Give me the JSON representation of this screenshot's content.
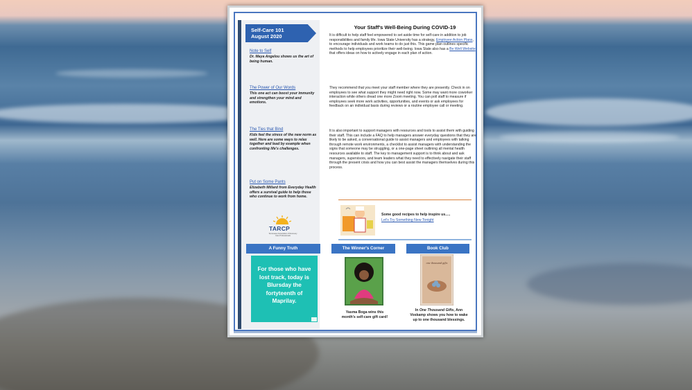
{
  "sidebar": {
    "banner": [
      "Self-Care 101",
      "August 2020"
    ],
    "items": [
      {
        "link": "Note to Self",
        "desc": "Dr. Maya Angelou shows us the art of being human."
      },
      {
        "link": "The Power of Our Words",
        "desc": "This one act can boost your immunity and strengthen your mind and emotions."
      },
      {
        "link": "The Ties that Bind",
        "desc": "Kids feel the stress of the new norm as well.  Here are some ways to relax together and lead by example when confronting life's challenges."
      },
      {
        "link": "Put on Some Pants",
        "desc": "Elizabeth Millard from Everyday Health offers a survival guide to help those who continue to work from home."
      }
    ],
    "logo": {
      "name": "TARCP",
      "sub": "Tennessee Association of Recovery Care Professionals"
    }
  },
  "article": {
    "title": "Your Staff's Well-Being During COVID-19",
    "p1_a": "It is difficult to help staff feel empowered to set aside time for self-care in addition to job responsibilities and family life. Iowa State University has a strategy, ",
    "p1_link1": "Employee Action Plans",
    "p1_b": ", to encourage individuals and work teams to do just this. This game plan outlines specific methods to help employees prioritize their well-being. Iowa State also has a ",
    "p1_link2": "Be Well Website",
    "p1_c": " that offers ideas on how to actively engage in each plan of action.",
    "p2": "They recommend that you meet your staff member where they are presently.  Check in on employees to see what support they might need right now.  Some may want more coworker interaction while others dread one more Zoom meeting.  You can poll staff to measure if employees seek more work activities, opportunities, and events or ask employees for feedback on an individual basis during reviews or a routine employee call or meeting.",
    "p3": "It is also important to support managers with resources and tools to assist them with guiding their staff.  This can include a FAQ to help managers answer everyday questions that they are likely to be asked, a conversational guide to assist managers and employees with talking through remote work environments, a checklist to assist managers with understanding the signs that someone may be struggling, or a one-page sheet outlining all mental health resources available to staff.  The key to management support is to think about and ask managers, supervisors, and team leaders what they need to effectively navigate their staff through the present crisis and how you can best assist the managers themselves during this process."
  },
  "recipes": {
    "title": "Some good recipes to help inspire us.....",
    "link": "Let's Try Something New Tonight"
  },
  "columns": {
    "funny": {
      "heading": "A Funny Truth",
      "text": [
        "For those who have",
        "lost track, today is",
        "Blursday the",
        "fortyteenth of",
        "Maprilay."
      ]
    },
    "winner": {
      "heading": "The Winner's Corner",
      "caption": [
        "Yasma Boga wins this",
        "month's self-care gift card!"
      ]
    },
    "book": {
      "heading": "Book Club",
      "caption_a": "In ",
      "caption_title": "One Thousand Gifts",
      "caption_b": ", Ann Voskamp shows you how to wake up to one thousand blessings.",
      "cover_title": "one thousand gifts"
    }
  },
  "colors": {
    "accent": "#2e62b0",
    "teal": "#1ec0b4",
    "orange_rule": "#d8823c"
  }
}
